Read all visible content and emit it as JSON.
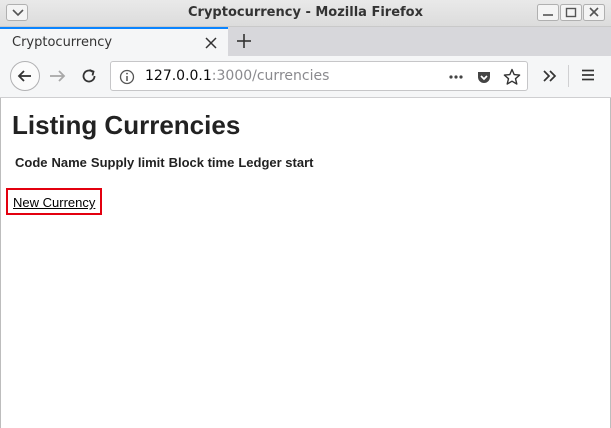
{
  "window": {
    "title": "Cryptocurrency - Mozilla Firefox"
  },
  "tabs": [
    {
      "label": "Cryptocurrency",
      "active": true
    }
  ],
  "navbar": {
    "url_host": "127.0.0.1",
    "url_path": ":3000/currencies"
  },
  "page": {
    "title": "Listing Currencies",
    "table_headers": [
      "Code",
      "Name",
      "Supply limit",
      "Block time",
      "Ledger start"
    ],
    "new_link": "New Currency"
  },
  "colors": {
    "tab_accent": "#0a84ff",
    "highlight_border": "#e3000f"
  }
}
